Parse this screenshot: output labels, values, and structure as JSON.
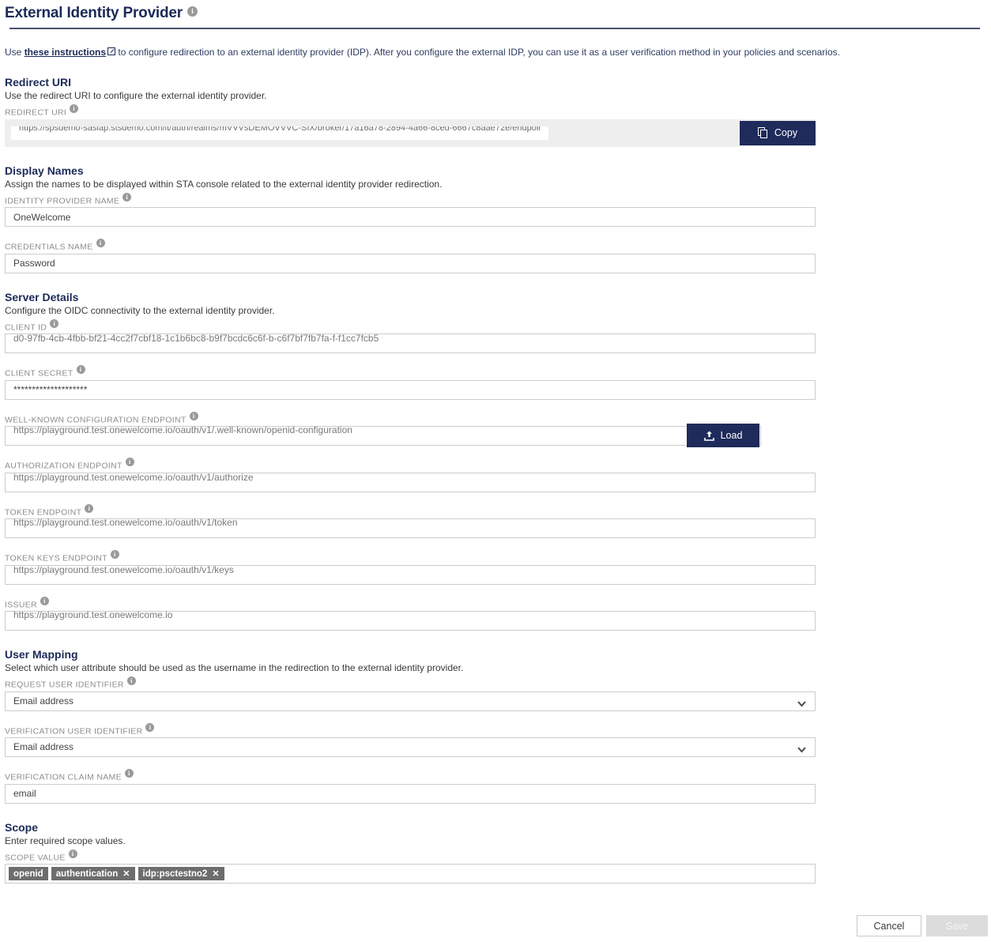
{
  "header": {
    "title": "External Identity Provider",
    "info_icon": "info-icon",
    "intro_prefix": "Use ",
    "intro_link": "these instructions",
    "intro_suffix": " to configure redirection to an external identity provider (IDP). After you configure the external IDP, you can use it as a user verification method in your policies and scenarios."
  },
  "redirect": {
    "section_title": "Redirect URI",
    "section_sub": "Use the redirect URI to configure the external identity provider.",
    "label": "REDIRECT URI",
    "value": "https://spsdemo-sasiap.stsdemo.com/it/auth/realms/mVVVsDEMOVVVC-SIX/broker/17a16a78-2894-4a66-8ced-6667c8aae72e/endpoint",
    "copy_label": "Copy"
  },
  "display_names": {
    "section_title": "Display Names",
    "section_sub": "Assign the names to be displayed within STA console related to the external identity provider redirection.",
    "idp_name_label": "IDENTITY PROVIDER NAME",
    "idp_name_value": "OneWelcome",
    "credentials_name_label": "CREDENTIALS NAME",
    "credentials_name_value": "Password"
  },
  "server_details": {
    "section_title": "Server Details",
    "section_sub": "Configure the OIDC connectivity to the external identity provider.",
    "client_id_label": "CLIENT ID",
    "client_id_value": "d0-97fb-4cb-4fbb-bf21-4cc2f7cbf18-1c1b6bc8-b9f7bcdc6c6f-b-c6f7bf7fb7fa-f-f1cc7fcb5",
    "client_secret_label": "CLIENT SECRET",
    "client_secret_value": "********************",
    "wellknown_label": "WELL-KNOWN CONFIGURATION ENDPOINT",
    "wellknown_value": "https://playground.test.onewelcome.io/oauth/v1/.well-known/openid-configuration",
    "load_label": "Load",
    "authorization_label": "AUTHORIZATION ENDPOINT",
    "authorization_value": "https://playground.test.onewelcome.io/oauth/v1/authorize",
    "token_label": "TOKEN ENDPOINT",
    "token_value": "https://playground.test.onewelcome.io/oauth/v1/token",
    "token_keys_label": "TOKEN KEYS ENDPOINT",
    "token_keys_value": "https://playground.test.onewelcome.io/oauth/v1/keys",
    "issuer_label": "ISSUER",
    "issuer_value": "https://playground.test.onewelcome.io"
  },
  "user_mapping": {
    "section_title": "User Mapping",
    "section_sub": "Select which user attribute should be used as the username in the redirection to the external identity provider.",
    "request_user_id_label": "REQUEST USER IDENTIFIER",
    "request_user_id_value": "Email address",
    "verification_user_id_label": "VERIFICATION USER IDENTIFIER",
    "verification_user_id_value": "Email address",
    "verification_claim_label": "VERIFICATION CLAIM NAME",
    "verification_claim_value": "email"
  },
  "scope": {
    "section_title": "Scope",
    "section_sub": "Enter required scope values.",
    "label": "SCOPE VALUE",
    "tags": [
      {
        "text": "openid",
        "removable": false
      },
      {
        "text": "authentication",
        "removable": true
      },
      {
        "text": "idp:psctestno2",
        "removable": true
      }
    ]
  },
  "footer": {
    "cancel_label": "Cancel",
    "save_label": "Save",
    "save_disabled": true
  },
  "colors": {
    "brand_navy": "#1f2b5b",
    "heading_navy": "#1b2a57",
    "field_border": "#cccccc",
    "label_grey": "#8d8d8d",
    "tag_grey": "#6d6d6d",
    "readonly_bg": "#eeeeee",
    "disabled_save_bg": "#dcdcdc"
  }
}
